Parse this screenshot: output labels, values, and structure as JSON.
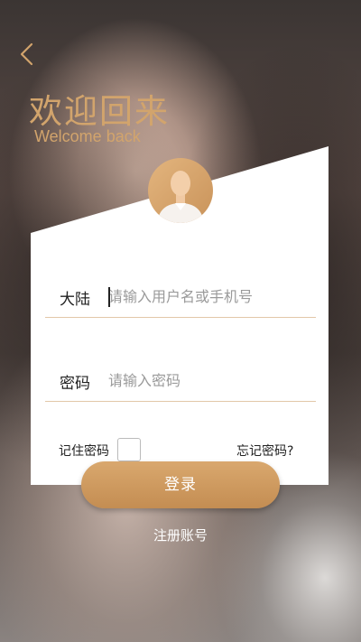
{
  "header": {
    "back_icon": "chevron-left-icon",
    "title": "欢迎回来",
    "subtitle": "Welcome back"
  },
  "form": {
    "avatar_icon": "user-avatar-icon",
    "region_label": "大陆",
    "username_placeholder": "请输入用户名或手机号",
    "username_value": "",
    "password_label": "密码",
    "password_placeholder": "请输入密码",
    "password_value": "",
    "remember_label": "记住密码",
    "remember_checked": false,
    "forgot_label": "忘记密码?",
    "login_label": "登录",
    "register_label": "注册账号"
  },
  "colors": {
    "accent": "#d2a46c",
    "button": "#c9935a",
    "card": "#ffffff",
    "divider": "#e2c7a8"
  }
}
